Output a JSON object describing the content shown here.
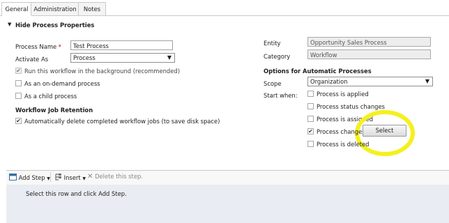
{
  "tabs": [
    "General",
    "Administration",
    "Notes"
  ],
  "section": {
    "title": "Hide Process Properties"
  },
  "left": {
    "process_name_label": "Process Name",
    "process_name_value": "Test Process",
    "activate_as_label": "Activate As",
    "activate_as_value": "Process",
    "opt_background": "Run this workflow in the background (recommended)",
    "opt_on_demand": "As an on-demand process",
    "opt_child": "As a child process",
    "retention_header": "Workflow Job Retention",
    "opt_auto_delete": "Automatically delete completed workflow jobs (to save disk space)"
  },
  "right": {
    "entity_label": "Entity",
    "entity_value": "Opportunity Sales Process",
    "category_label": "Category",
    "category_value": "Workflow",
    "auto_header": "Options for Automatic Processes",
    "scope_label": "Scope",
    "scope_value": "Organization",
    "start_when_label": "Start when:",
    "start_options": [
      "Process is applied",
      "Process status changes",
      "Process is assigned",
      "Process changes",
      "Process is deleted"
    ],
    "select_button": "Select"
  },
  "toolbar": {
    "add_step": "Add Step",
    "insert": "Insert",
    "delete_step": "Delete this step."
  },
  "grid": {
    "hint": "Select this row and click Add Step."
  },
  "colors": {
    "highlight": "#f5f01e",
    "required": "#cc0000"
  }
}
